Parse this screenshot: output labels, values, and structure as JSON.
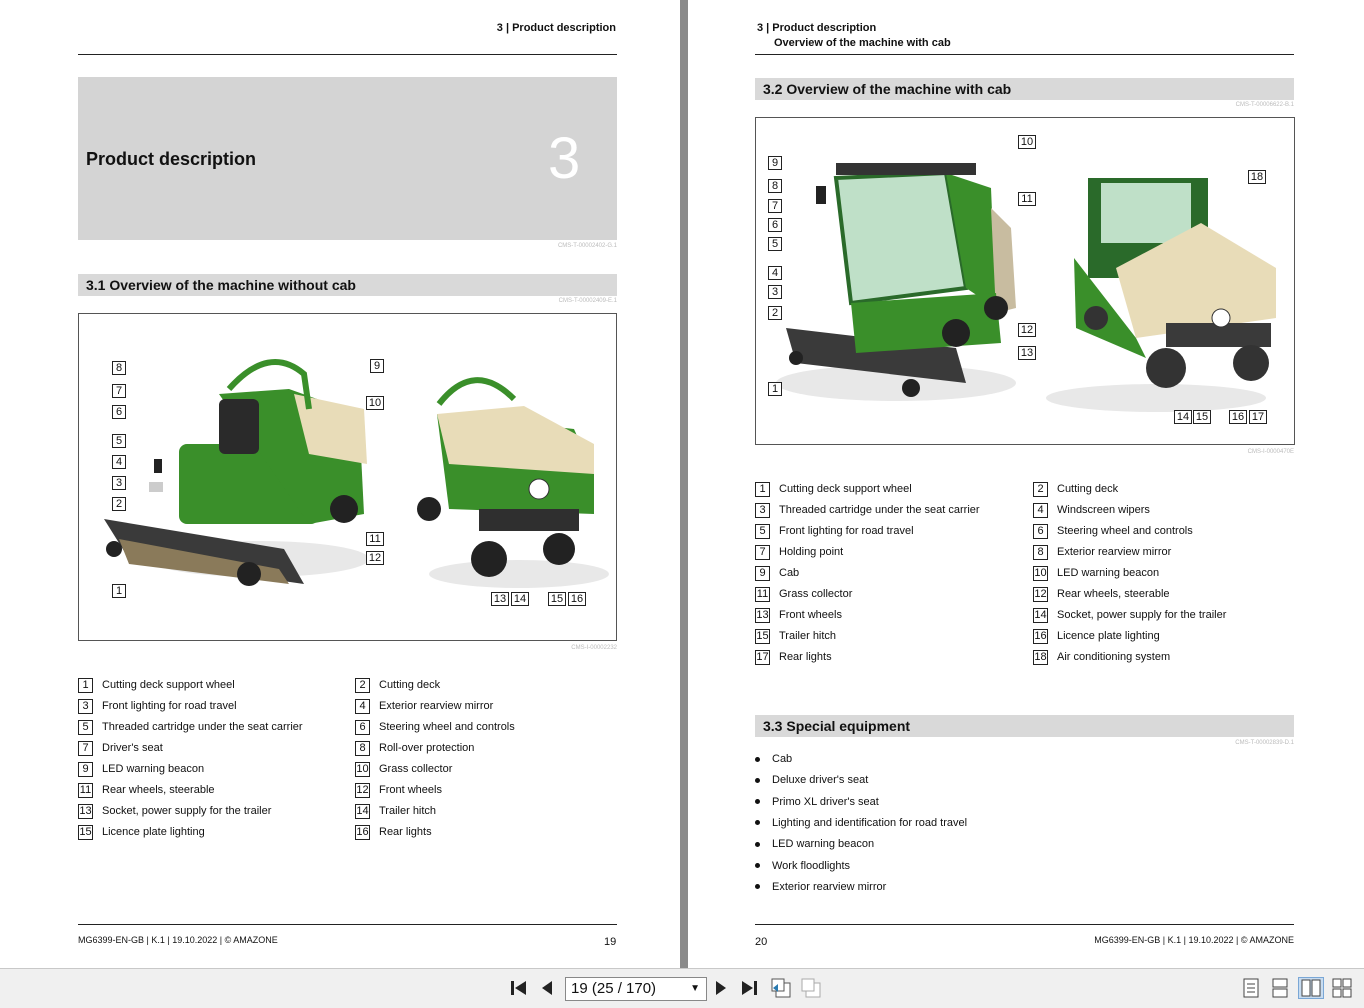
{
  "left_page": {
    "header": "3 | Product description",
    "chapter_title": "Product description",
    "chapter_number": "3",
    "cms_chapter": "CMS-T-00002402-G.1",
    "section_title": "3.1  Overview of the machine without cab",
    "cms_section": "CMS-T-00002409-E.1",
    "figure_callouts": [
      "8",
      "7",
      "6",
      "5",
      "4",
      "3",
      "2",
      "1",
      "9",
      "10",
      "11",
      "12",
      "13",
      "14",
      "15",
      "16"
    ],
    "cms_figure": "CMS-I-00002232",
    "legend": [
      {
        "n": "1",
        "label": "Cutting deck support wheel"
      },
      {
        "n": "2",
        "label": "Cutting deck"
      },
      {
        "n": "3",
        "label": "Front lighting for road travel"
      },
      {
        "n": "4",
        "label": "Exterior rearview mirror"
      },
      {
        "n": "5",
        "label": "Threaded cartridge under the seat carrier"
      },
      {
        "n": "6",
        "label": "Steering wheel and controls"
      },
      {
        "n": "7",
        "label": "Driver's seat"
      },
      {
        "n": "8",
        "label": "Roll-over protection"
      },
      {
        "n": "9",
        "label": "LED warning beacon"
      },
      {
        "n": "10",
        "label": "Grass collector"
      },
      {
        "n": "11",
        "label": "Rear wheels, steerable"
      },
      {
        "n": "12",
        "label": "Front wheels"
      },
      {
        "n": "13",
        "label": "Socket, power supply for the trailer"
      },
      {
        "n": "14",
        "label": "Trailer hitch"
      },
      {
        "n": "15",
        "label": "Licence plate lighting"
      },
      {
        "n": "16",
        "label": "Rear lights"
      }
    ],
    "footer": "MG6399-EN-GB | K.1 | 19.10.2022 | © AMAZONE",
    "page_number": "19"
  },
  "right_page": {
    "header_line1": "3 | Product description",
    "header_line2": "Overview of the machine with cab",
    "section_title": "3.2  Overview of the machine with cab",
    "cms_section": "CMS-T-00006622-B.1",
    "cms_figure": "CMS-I-0000470E",
    "legend": [
      {
        "n": "1",
        "label": "Cutting deck support wheel"
      },
      {
        "n": "2",
        "label": "Cutting deck"
      },
      {
        "n": "3",
        "label": "Threaded cartridge under the seat carrier"
      },
      {
        "n": "4",
        "label": "Windscreen wipers"
      },
      {
        "n": "5",
        "label": "Front lighting for road travel"
      },
      {
        "n": "6",
        "label": "Steering wheel and controls"
      },
      {
        "n": "7",
        "label": "Holding point"
      },
      {
        "n": "8",
        "label": "Exterior rearview mirror"
      },
      {
        "n": "9",
        "label": "Cab"
      },
      {
        "n": "10",
        "label": "LED warning beacon"
      },
      {
        "n": "11",
        "label": "Grass collector"
      },
      {
        "n": "12",
        "label": "Rear wheels, steerable"
      },
      {
        "n": "13",
        "label": "Front wheels"
      },
      {
        "n": "14",
        "label": "Socket, power supply for the trailer"
      },
      {
        "n": "15",
        "label": "Trailer hitch"
      },
      {
        "n": "16",
        "label": "Licence plate lighting"
      },
      {
        "n": "17",
        "label": "Rear lights"
      },
      {
        "n": "18",
        "label": "Air conditioning system"
      }
    ],
    "special_title": "3.3  Special equipment",
    "cms_special": "CMS-T-00002839-D.1",
    "special_items": [
      "Cab",
      "Deluxe driver's seat",
      "Primo XL driver's seat",
      "Lighting and identification for road travel",
      "LED warning beacon",
      "Work floodlights",
      "Exterior rearview mirror"
    ],
    "footer": "MG6399-EN-GB | K.1 | 19.10.2022 | © AMAZONE",
    "page_number": "20"
  },
  "toolbar": {
    "page_select_value": "19 (25 / 170)",
    "icons": [
      "first-page-icon",
      "previous-page-icon",
      "dropdown-arrow-icon",
      "next-page-icon",
      "last-page-icon",
      "go-back-view-icon",
      "go-forward-view-icon",
      "single-page-view-icon",
      "continuous-view-icon",
      "facing-pages-view-icon",
      "continuous-facing-view-icon"
    ]
  },
  "colors": {
    "section_bar": "#d9d9d9",
    "chapter_box": "#d4d4d4",
    "mower_green": "#3a8f2a",
    "collector_beige": "#e8dcb8"
  }
}
